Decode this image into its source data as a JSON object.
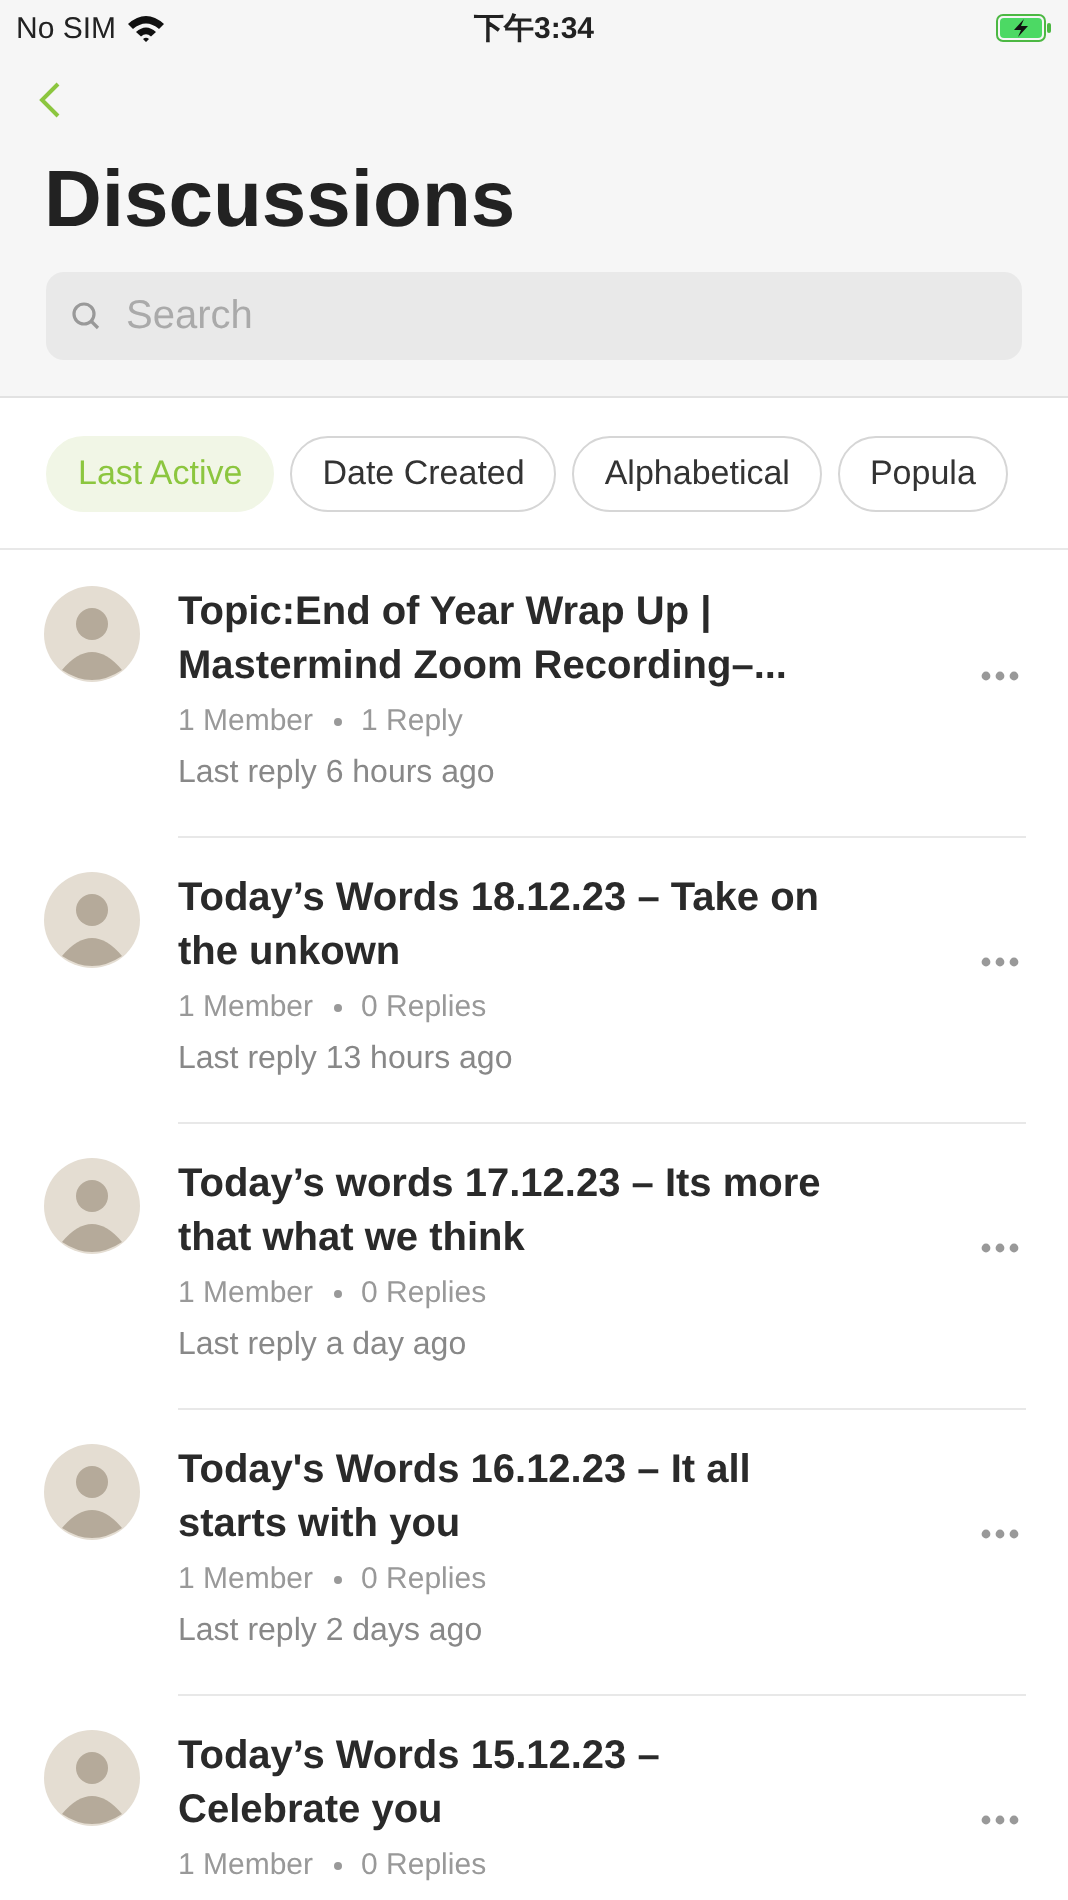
{
  "status_bar": {
    "carrier": "No SIM",
    "time": "下午3:34"
  },
  "title": "Discussions",
  "search": {
    "placeholder": "Search"
  },
  "filters": [
    {
      "label": "Last Active",
      "selected": true
    },
    {
      "label": "Date Created",
      "selected": false
    },
    {
      "label": "Alphabetical",
      "selected": false
    },
    {
      "label": "Popula",
      "selected": false
    }
  ],
  "discussions": [
    {
      "title": "Topic:End of Year Wrap Up | Mastermind Zoom Recording–...",
      "members": "1 Member",
      "replies": "1 Reply",
      "last_reply": "Last reply 6 hours ago"
    },
    {
      "title": "Today’s Words 18.12.23 – Take on the unkown",
      "members": "1 Member",
      "replies": "0 Replies",
      "last_reply": "Last reply 13 hours ago"
    },
    {
      "title": "Today’s words 17.12.23 – Its more that what we think",
      "members": "1 Member",
      "replies": "0 Replies",
      "last_reply": "Last reply a day ago"
    },
    {
      "title": "Today's Words 16.12.23 – It all starts with you",
      "members": "1 Member",
      "replies": "0 Replies",
      "last_reply": "Last reply 2 days ago"
    },
    {
      "title": "Today’s Words 15.12.23 – Celebrate you",
      "members": "1 Member",
      "replies": "0 Replies"
    }
  ]
}
